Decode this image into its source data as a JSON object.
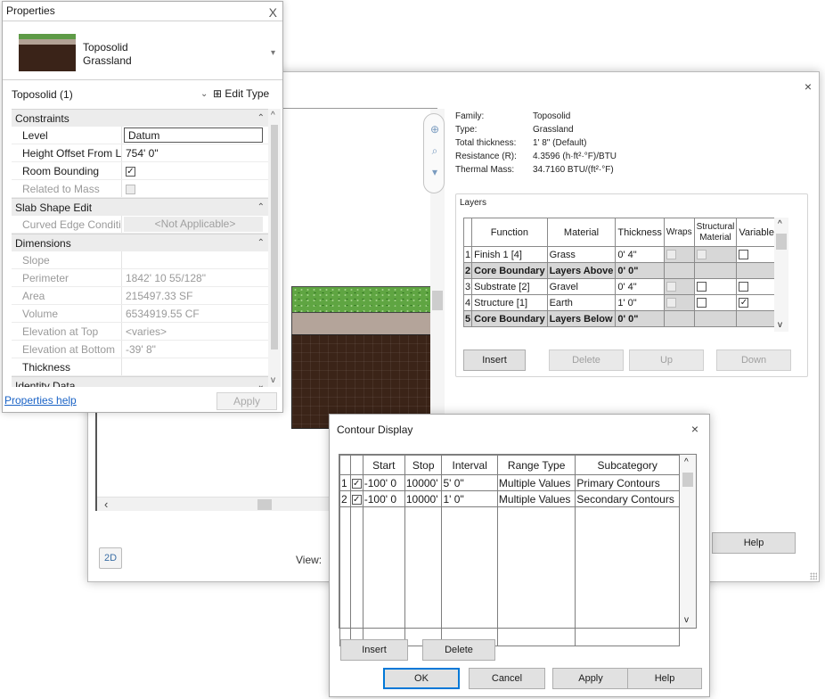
{
  "assembly": {
    "close_glyph": "×",
    "view_label": "View:",
    "zoom_label": "2D",
    "info": [
      {
        "key": "Family:",
        "value": "Toposolid"
      },
      {
        "key": "Type:",
        "value": "Grassland"
      },
      {
        "key": "Total thickness:",
        "value": "1'  8\" (Default)"
      },
      {
        "key": "Resistance (R):",
        "value": "4.3596 (h·ft²·°F)/BTU"
      },
      {
        "key": "Thermal Mass:",
        "value": "34.7160 BTU/(ft²·°F)"
      }
    ],
    "layers_caption": "Layers",
    "layers_headers": [
      "",
      "Function",
      "Material",
      "Thickness",
      "Wraps",
      "Structural Material",
      "Variable"
    ],
    "layers": [
      {
        "n": "1",
        "function": "Finish 1 [4]",
        "material": "Grass",
        "thickness": "0'  4\"",
        "core": false,
        "variable": false
      },
      {
        "n": "2",
        "function": "Core Boundary",
        "material": "Layers Above",
        "thickness": "0'  0\"",
        "core": true,
        "variable": false
      },
      {
        "n": "3",
        "function": "Substrate [2]",
        "material": "Gravel",
        "thickness": "0'  4\"",
        "core": false,
        "variable": false
      },
      {
        "n": "4",
        "function": "Structure [1]",
        "material": "Earth",
        "thickness": "1'  0\"",
        "core": false,
        "variable": true
      },
      {
        "n": "5",
        "function": "Core Boundary",
        "material": "Layers Below",
        "thickness": "0'  0\"",
        "core": true,
        "variable": false
      }
    ],
    "buttons": {
      "insert": "Insert",
      "delete": "Delete",
      "up": "Up",
      "down": "Down",
      "help": "Help"
    }
  },
  "properties": {
    "title": "Properties",
    "close_glyph": "X",
    "family_name": "Toposolid",
    "type_name": "Grassland",
    "instance_label": "Toposolid (1)",
    "edit_type_label": "Edit Type",
    "sections": [
      {
        "name": "Constraints",
        "rows": [
          {
            "name": "Level",
            "value": "Datum",
            "style": "boxed"
          },
          {
            "name": "Height Offset From L...",
            "value": "754'  0\"",
            "style": ""
          },
          {
            "name": "Room Bounding",
            "value": "",
            "style": "check-on"
          },
          {
            "name": "Related to Mass",
            "value": "",
            "style": "check-off-ro"
          }
        ]
      },
      {
        "name": "Slab Shape Edit",
        "rows": [
          {
            "name": "Curved Edge Conditi...",
            "value": "<Not Applicable>",
            "style": "na"
          }
        ]
      },
      {
        "name": "Dimensions",
        "rows": [
          {
            "name": "Slope",
            "value": "",
            "style": "ro"
          },
          {
            "name": "Perimeter",
            "value": "1842'  10 55/128\"",
            "style": "ro"
          },
          {
            "name": "Area",
            "value": "215497.33 SF",
            "style": "ro"
          },
          {
            "name": "Volume",
            "value": "6534919.55 CF",
            "style": "ro"
          },
          {
            "name": "Elevation at Top",
            "value": "<varies>",
            "style": "ro"
          },
          {
            "name": "Elevation at Bottom",
            "value": "-39'  8\"",
            "style": "ro"
          },
          {
            "name": "Thickness",
            "value": "",
            "style": ""
          }
        ]
      },
      {
        "name": "Identity Data",
        "rows": []
      }
    ],
    "help_link": "Properties help",
    "apply_label": "Apply"
  },
  "contour": {
    "title": "Contour Display",
    "close_glyph": "×",
    "headers": [
      "",
      "",
      "Start",
      "Stop",
      "Interval",
      "Range Type",
      "Subcategory"
    ],
    "rows": [
      {
        "n": "1",
        "start": "-100'  0",
        "stop": "10000'",
        "interval": "5'  0\"",
        "range_type": "Multiple Values",
        "subcategory": "Primary Contours"
      },
      {
        "n": "2",
        "start": "-100'  0",
        "stop": "10000'",
        "interval": "1'  0\"",
        "range_type": "Multiple Values",
        "subcategory": "Secondary Contours"
      }
    ],
    "buttons": {
      "insert": "Insert",
      "delete": "Delete",
      "ok": "OK",
      "cancel": "Cancel",
      "apply": "Apply",
      "help": "Help"
    }
  }
}
